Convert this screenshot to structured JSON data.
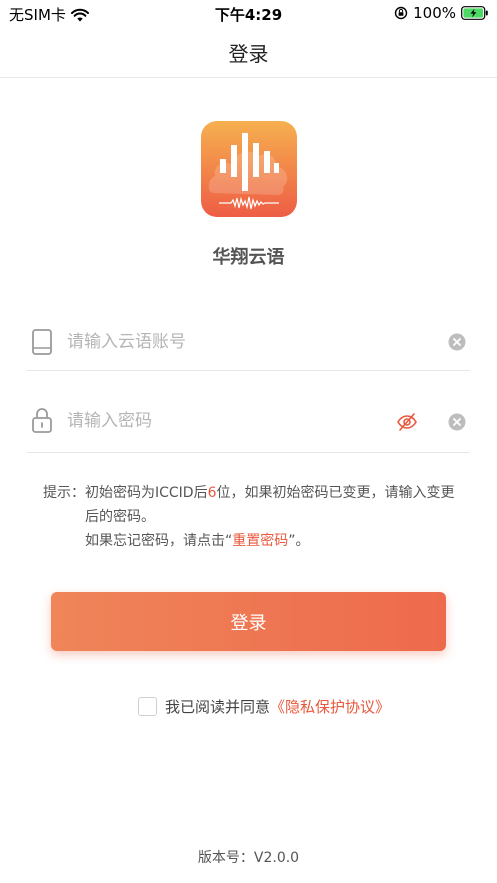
{
  "status_bar": {
    "carrier": "无SIM卡",
    "time": "下午4:29",
    "battery_percent": "100%"
  },
  "nav": {
    "title": "登录"
  },
  "app": {
    "name": "华翔云语"
  },
  "account": {
    "placeholder": "请输入云语账号",
    "value": ""
  },
  "password": {
    "placeholder": "请输入密码",
    "value": ""
  },
  "hint": {
    "label": "提示：",
    "line1_a": "初始密码为ICCID后",
    "line1_num": "6",
    "line1_b": "位，如果初始密码已变更，请输入变更后的密码。",
    "line2_a": "如果忘记密码，请点击“",
    "line2_link": "重置密码",
    "line2_b": "”。"
  },
  "login_button": {
    "label": "登录"
  },
  "agreement": {
    "text": "我已阅读并同意",
    "link": "《隐私保护协议》",
    "checked": false
  },
  "version": {
    "text": "版本号：V2.0.0"
  },
  "colors": {
    "accent": "#ee6a4c",
    "accent_light": "#ef8559",
    "link": "#e8583c"
  },
  "icons": {
    "wifi": "wifi-icon",
    "orientation_lock": "orientation-lock-icon",
    "battery": "battery-charging-icon",
    "phone": "phone-icon",
    "lock": "lock-icon",
    "eye_hidden": "eye-slash-icon",
    "clear": "clear-icon"
  }
}
